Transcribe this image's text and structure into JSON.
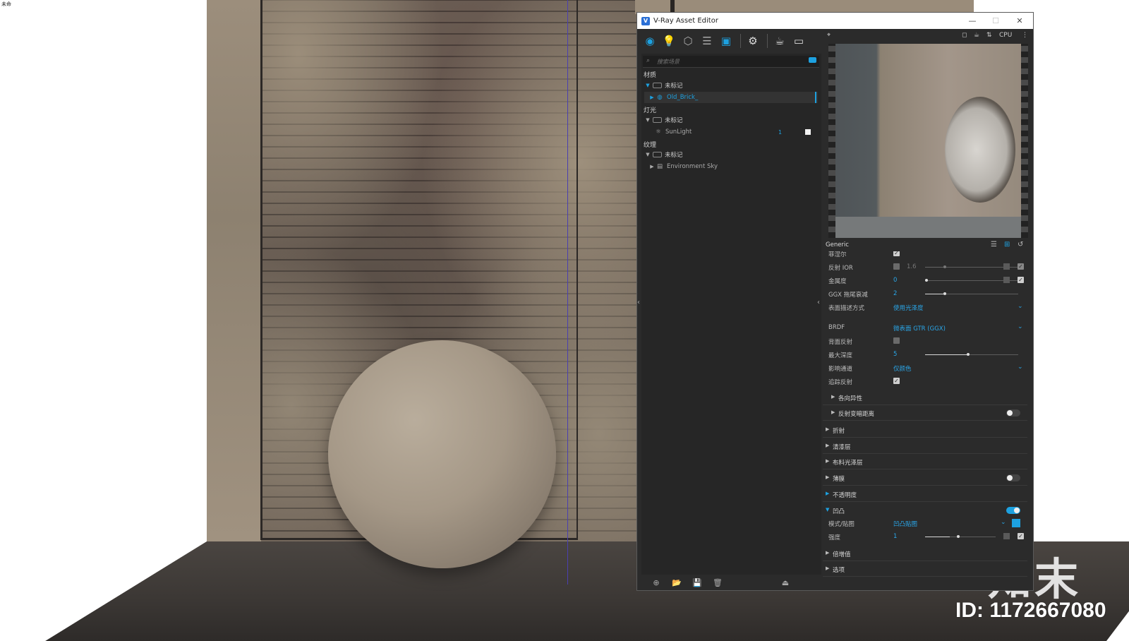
{
  "viewport": {
    "corner_label": "未命",
    "watermark_logo": "知末",
    "watermark_id": "ID: 1172667080"
  },
  "window": {
    "title": "V-Ray Asset Editor",
    "controls": {
      "minimize": "—",
      "maximize": "☐",
      "close": "✕"
    }
  },
  "toolbar": {
    "icons": [
      "materials-icon",
      "lights-icon",
      "geometry-icon",
      "layers-icon",
      "textures-icon",
      "settings-icon",
      "render-teapot-icon",
      "frame-buffer-icon"
    ]
  },
  "search": {
    "placeholder": "搜索场景"
  },
  "outliner": {
    "materials_title": "材质",
    "materials_group": "未标记",
    "material_item": "Old_Brick_",
    "lights_title": "灯光",
    "lights_group": "未标记",
    "light_item": "SunLight",
    "light_count": "1",
    "textures_title": "纹理",
    "textures_group": "未标记",
    "texture_item": "Environment Sky"
  },
  "preview": {
    "render_mode": "CPU"
  },
  "properties": {
    "header": "Generic",
    "rows": {
      "fresnel": "菲涅尔",
      "reflection_ior": "反射 IOR",
      "reflection_ior_value": "1.6",
      "metalness": "金属度",
      "metalness_value": "0",
      "ggx_tail": "GGX 拖尾衰减",
      "ggx_tail_value": "2",
      "surface_mode": "表面描述方式",
      "surface_mode_value": "使用光泽度",
      "brdf": "BRDF",
      "brdf_value": "微表面 GTR (GGX)",
      "back_reflect": "背面反射",
      "max_depth": "最大深度",
      "max_depth_value": "5",
      "affect_channels": "影响通道",
      "affect_channels_value": "仅颜色",
      "trace_reflections": "追踪反射"
    },
    "sections": {
      "anisotropy": "各向异性",
      "reflection_dim": "反射变暗距离",
      "refraction": "折射",
      "coat": "清漆层",
      "sheen": "布料光泽层",
      "thin_film": "薄膜",
      "opacity": "不透明度",
      "bump": "凹凸",
      "bump_mode": "模式/贴图",
      "bump_mode_value": "凹凸贴图",
      "bump_amount": "强度",
      "bump_amount_value": "1",
      "multiplier": "倍增值",
      "options": "选项"
    },
    "slider_levels": {
      "reflection_ior": 0.2,
      "metalness": 0.0,
      "ggx_tail": 0.2,
      "max_depth": 0.45,
      "bump_amount": 0.35
    }
  },
  "colors": {
    "accent": "#1da1e0",
    "panel": "#2b2b2b"
  }
}
